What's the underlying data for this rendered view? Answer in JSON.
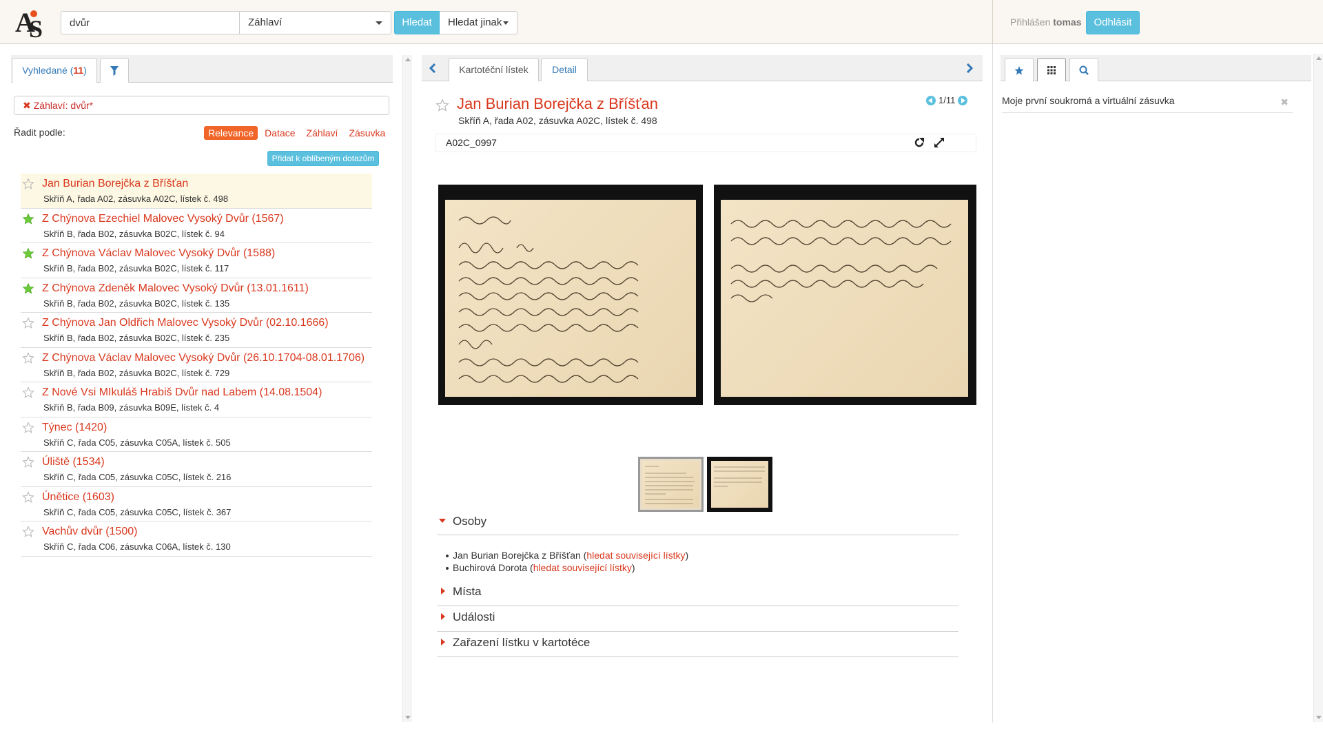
{
  "header": {
    "search_value": "dvůr",
    "field_select": "Záhlaví",
    "search_button": "Hledat",
    "search_other_button": "Hledat jinak",
    "logged_in_prefix": "Přihlášen",
    "username": "tomas",
    "logout_button": "Odhlásit"
  },
  "left": {
    "tab_found_label": "Vyhledané (",
    "tab_found_count": "11",
    "tab_found_suffix": ")",
    "filter_chip": "Záhlaví: dvůr*",
    "sort_label": "Řadit podle:",
    "sort_options": [
      "Relevance",
      "Datace",
      "Záhlaví",
      "Zásuvka"
    ],
    "add_favorite_button": "Přidat k oblíbeným dotazům",
    "results": [
      {
        "title": "Jan Burian Borejčka z Bříšťan",
        "subtitle": "Skříň A, řada A02, zásuvka A02C, lístek č. 498",
        "starred": false,
        "selected": true
      },
      {
        "title": "Z Chýnova Ezechiel Malovec Vysoký Dvůr (1567)",
        "subtitle": "Skříň B, řada B02, zásuvka B02C, lístek č. 94",
        "starred": true,
        "selected": false
      },
      {
        "title": "Z Chýnova Václav Malovec Vysoký Dvůr (1588)",
        "subtitle": "Skříň B, řada B02, zásuvka B02C, lístek č. 117",
        "starred": true,
        "selected": false
      },
      {
        "title": "Z Chýnova Zdeněk Malovec Vysoký Dvůr (13.01.1611)",
        "subtitle": "Skříň B, řada B02, zásuvka B02C, lístek č. 135",
        "starred": true,
        "selected": false
      },
      {
        "title": "Z Chýnova Jan Oldřich Malovec Vysoký Dvůr (02.10.1666)",
        "subtitle": "Skříň B, řada B02, zásuvka B02C, lístek č. 235",
        "starred": false,
        "selected": false
      },
      {
        "title": "Z Chýnova Václav Malovec Vysoký Dvůr (26.10.1704-08.01.1706)",
        "subtitle": "Skříň B, řada B02, zásuvka B02C, lístek č. 729",
        "starred": false,
        "selected": false
      },
      {
        "title": "Z Nové Vsi MIkuláš Hrabiš Dvůr nad Labem (14.08.1504)",
        "subtitle": "Skříň B, řada B09, zásuvka B09E, lístek č. 4",
        "starred": false,
        "selected": false
      },
      {
        "title": "Týnec (1420)",
        "subtitle": "Skříň C, řada C05, zásuvka C05A, lístek č. 505",
        "starred": false,
        "selected": false
      },
      {
        "title": "Úliště (1534)",
        "subtitle": "Skříň C, řada C05, zásuvka C05C, lístek č. 216",
        "starred": false,
        "selected": false
      },
      {
        "title": "Únětice (1603)",
        "subtitle": "Skříň C, řada C05, zásuvka C05C, lístek č. 367",
        "starred": false,
        "selected": false
      },
      {
        "title": "Vachův dvůr (1500)",
        "subtitle": "Skříň C, řada C06, zásuvka C06A, lístek č. 130",
        "starred": false,
        "selected": false
      }
    ]
  },
  "center": {
    "tab_card": "Kartotéční lístek",
    "tab_detail": "Detail",
    "title": "Jan Burian Borejčka z Bříšťan",
    "subtitle": "Skříň A, řada A02, zásuvka A02C, lístek č. 498",
    "pager": "1/11",
    "code": "A02C_0997",
    "sections": {
      "persons": "Osoby",
      "places": "Místa",
      "events": "Události",
      "classification": "Zařazení lístku v kartotéce"
    },
    "persons": [
      {
        "name": "Jan Burian Borejčka z Bříšťan",
        "link": "hledat související lístky"
      },
      {
        "name": "Buchirová Dorota",
        "link": "hledat související lístky"
      }
    ]
  },
  "right": {
    "drawer_item": "Moje první soukromá a virtuální zásuvka",
    "close": "✖"
  }
}
